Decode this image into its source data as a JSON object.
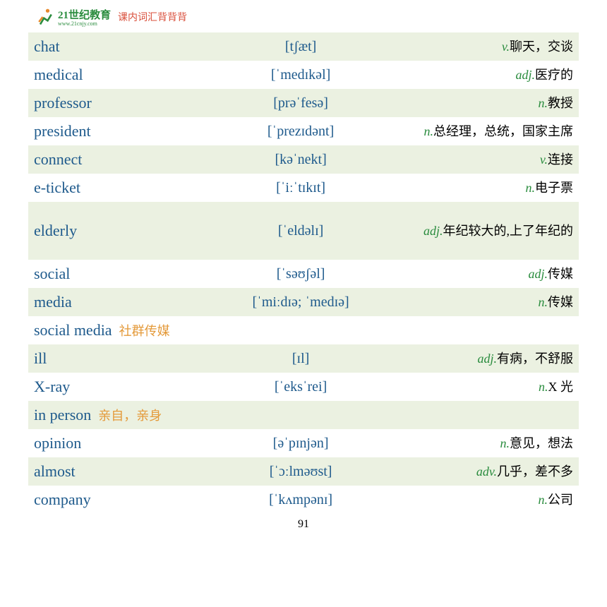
{
  "header": {
    "logo_main": "21世纪教育",
    "logo_sub": "www.21cnjy.com",
    "section_title": "课内词汇背背背"
  },
  "rows": [
    {
      "word": "chat",
      "phon": "[tʃæt]",
      "pos": "v.",
      "def": "聊天，交谈",
      "inline": "",
      "tall": false
    },
    {
      "word": "medical",
      "phon": "[ˈmedɪkəl]",
      "pos": "adj.",
      "def": "医疗的",
      "inline": "",
      "tall": false
    },
    {
      "word": "professor",
      "phon": "[prəˈfesə]",
      "pos": "n.",
      "def": "教授",
      "inline": "",
      "tall": false
    },
    {
      "word": "president",
      "phon": "[ˈprezɪdənt]",
      "pos": "n.",
      "def": "总经理，总统，国家主席",
      "inline": "",
      "tall": false
    },
    {
      "word": "connect",
      "phon": "[kəˈnekt]",
      "pos": "v.",
      "def": "连接",
      "inline": "",
      "tall": false
    },
    {
      "word": "e-ticket",
      "phon": "[ˈiːˈtɪkɪt]",
      "pos": "n.",
      "def": "电子票",
      "inline": "",
      "tall": false
    },
    {
      "word": "elderly",
      "phon": "[ˈeldəlɪ]",
      "pos": "adj.",
      "def": "年纪较大的,上了年纪的",
      "inline": "",
      "tall": true
    },
    {
      "word": "social",
      "phon": "[ˈsəʊʃəl]",
      "pos": "adj.",
      "def": "传媒",
      "inline": "",
      "tall": false
    },
    {
      "word": "media",
      "phon": "[ˈmiːdɪə; ˈmedɪə]",
      "pos": "n.",
      "def": "传媒",
      "inline": "",
      "tall": false
    },
    {
      "word": "social media",
      "phon": "",
      "pos": "",
      "def": "",
      "inline": "社群传媒",
      "tall": false
    },
    {
      "word": "ill",
      "phon": "[ɪl]",
      "pos": "adj.",
      "def": "有病，不舒服",
      "inline": "",
      "tall": false
    },
    {
      "word": "X-ray",
      "phon": "[ˈeksˈrei]",
      "pos": "n.",
      "def": "X 光",
      "inline": "",
      "tall": false
    },
    {
      "word": "in person",
      "phon": "",
      "pos": "",
      "def": "",
      "inline": "亲自，亲身",
      "tall": false
    },
    {
      "word": "opinion",
      "phon": "[əˈpɪnjən]",
      "pos": "n.",
      "def": "意见，想法",
      "inline": "",
      "tall": false
    },
    {
      "word": "almost",
      "phon": "[ˈɔːlməʊst]",
      "pos": "adv.",
      "def": "几乎，差不多",
      "inline": "",
      "tall": false
    },
    {
      "word": "company",
      "phon": "[ˈkʌmpənɪ]",
      "pos": "n.",
      "def": "公司",
      "inline": "",
      "tall": false
    }
  ],
  "page_number": "91"
}
